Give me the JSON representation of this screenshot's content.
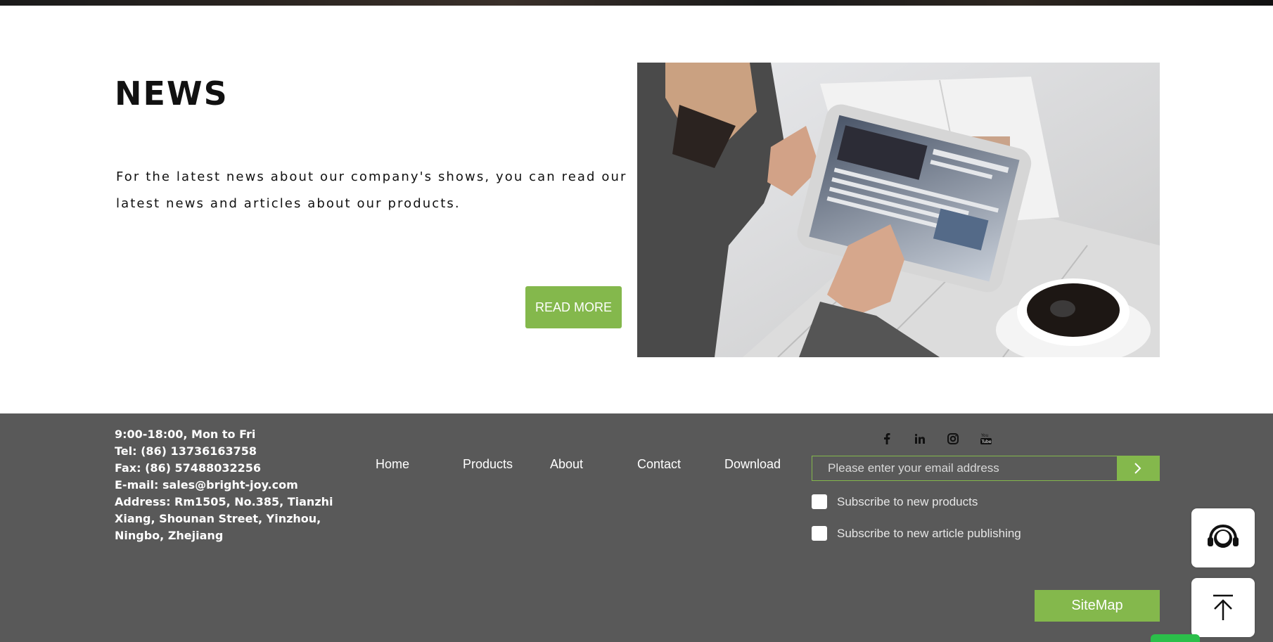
{
  "news": {
    "title": "NEWS",
    "description": "For the latest news about our company's shows, you can read our latest news and articles about our products.",
    "read_more_label": "READ MORE"
  },
  "footer": {
    "contact": {
      "hours": "9:00-18:00, Mon to Fri",
      "tel": "Tel: (86) 13736163758",
      "fax": "Fax: (86) 57488032256",
      "email": "E-mail: sales@bright-joy.com",
      "address": "Address: Rm1505, No.385, Tianzhi Xiang, Shounan Street, Yinzhou, Ningbo, Zhejiang"
    },
    "nav": {
      "home": "Home",
      "products": "Products",
      "about": "About",
      "contact": "Contact",
      "download": "Download"
    },
    "social_icons": [
      "facebook-icon",
      "linkedin-icon",
      "instagram-icon",
      "youtube-icon"
    ],
    "subscribe": {
      "placeholder": "Please enter your email address",
      "option_products": "Subscribe to new products",
      "option_articles": "Subscribe to new article publishing"
    },
    "sitemap_label": "SiteMap"
  },
  "floating": {
    "support_icon": "headset-icon",
    "top_icon": "back-to-top-icon"
  },
  "colors": {
    "accent_green": "#84b84c",
    "footer_bg": "#595959",
    "chat_green": "#2bbf4a"
  }
}
